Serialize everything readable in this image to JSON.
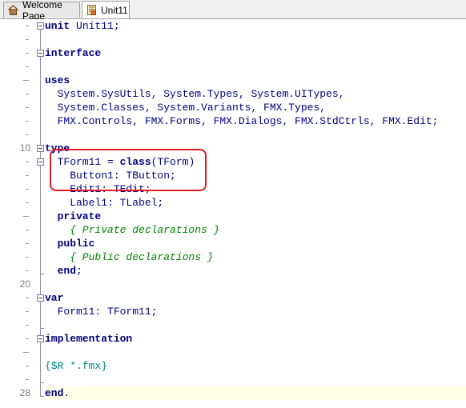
{
  "tabs": [
    {
      "label": "Welcome Page",
      "icon": "house-icon"
    },
    {
      "label": "Unit11",
      "icon": "unit-file-icon",
      "active": true
    }
  ],
  "gutter": {
    "numbers": [
      {
        "line": 10,
        "label": "10"
      },
      {
        "line": 20,
        "label": "20"
      },
      {
        "line": 28,
        "label": "28"
      }
    ]
  },
  "code": {
    "lines": [
      {
        "n": 1,
        "segments": [
          {
            "t": "kw",
            "v": "unit"
          },
          {
            "t": "plain",
            "v": " Unit11;"
          }
        ]
      },
      {
        "n": 2,
        "segments": []
      },
      {
        "n": 3,
        "segments": [
          {
            "t": "kw",
            "v": "interface"
          }
        ]
      },
      {
        "n": 4,
        "segments": []
      },
      {
        "n": 5,
        "segments": [
          {
            "t": "kw",
            "v": "uses"
          }
        ]
      },
      {
        "n": 6,
        "segments": [
          {
            "t": "plain",
            "v": "  System.SysUtils, System.Types, System.UITypes,"
          }
        ]
      },
      {
        "n": 7,
        "segments": [
          {
            "t": "plain",
            "v": "  System.Classes, System.Variants, FMX.Types,"
          }
        ]
      },
      {
        "n": 8,
        "segments": [
          {
            "t": "plain",
            "v": "  FMX.Controls, FMX.Forms, FMX.Dialogs, FMX.StdCtrls, FMX.Edit;"
          }
        ]
      },
      {
        "n": 9,
        "segments": []
      },
      {
        "n": 10,
        "segments": [
          {
            "t": "kw",
            "v": "type"
          }
        ]
      },
      {
        "n": 11,
        "segments": [
          {
            "t": "plain",
            "v": "  TForm11 = "
          },
          {
            "t": "kw",
            "v": "class"
          },
          {
            "t": "plain",
            "v": "(TForm)"
          }
        ]
      },
      {
        "n": 12,
        "segments": [
          {
            "t": "plain",
            "v": "    Button1: TButton;"
          }
        ]
      },
      {
        "n": 13,
        "segments": [
          {
            "t": "plain",
            "v": "    Edit1: TEdit;"
          }
        ]
      },
      {
        "n": 14,
        "segments": [
          {
            "t": "plain",
            "v": "    Label1: TLabel;"
          }
        ]
      },
      {
        "n": 15,
        "segments": [
          {
            "t": "kw",
            "v": "  private"
          }
        ]
      },
      {
        "n": 16,
        "segments": [
          {
            "t": "cmt",
            "v": "    { Private declarations }"
          }
        ]
      },
      {
        "n": 17,
        "segments": [
          {
            "t": "kw",
            "v": "  public"
          }
        ]
      },
      {
        "n": 18,
        "segments": [
          {
            "t": "cmt",
            "v": "    { Public declarations }"
          }
        ]
      },
      {
        "n": 19,
        "segments": [
          {
            "t": "kw",
            "v": "  end"
          },
          {
            "t": "plain",
            "v": ";"
          }
        ]
      },
      {
        "n": 20,
        "segments": []
      },
      {
        "n": 21,
        "segments": [
          {
            "t": "kw",
            "v": "var"
          }
        ]
      },
      {
        "n": 22,
        "segments": [
          {
            "t": "plain",
            "v": "  Form11: TForm11;"
          }
        ]
      },
      {
        "n": 23,
        "segments": []
      },
      {
        "n": 24,
        "segments": [
          {
            "t": "kw",
            "v": "implementation"
          }
        ]
      },
      {
        "n": 25,
        "segments": []
      },
      {
        "n": 26,
        "segments": [
          {
            "t": "dir",
            "v": "{$R *.fmx}"
          }
        ]
      },
      {
        "n": 27,
        "segments": []
      },
      {
        "n": 28,
        "segments": [
          {
            "t": "kw",
            "v": "end"
          },
          {
            "t": "plain",
            "v": "."
          }
        ],
        "current": true
      }
    ]
  },
  "colors": {
    "keyword": "#000080",
    "comment": "#008000",
    "directive": "#008080",
    "highlight": "#e31b23",
    "current_line": "#ffffe8"
  }
}
